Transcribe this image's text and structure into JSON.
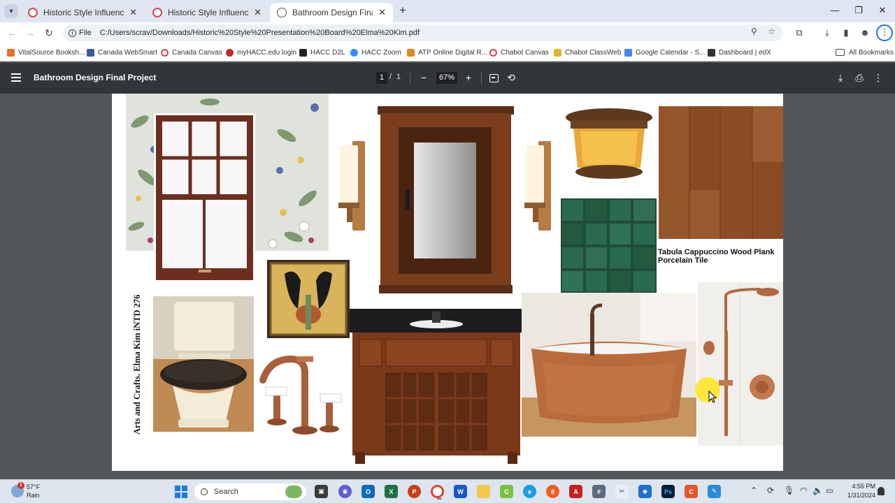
{
  "browser": {
    "tabs": [
      {
        "label": "Historic Style Influence Project",
        "favicon": "canvas-icon",
        "active": false
      },
      {
        "label": "Historic Style Influence Project",
        "favicon": "canvas-icon",
        "active": false
      },
      {
        "label": "Bathroom Design Final Project",
        "favicon": "globe-icon",
        "active": true
      }
    ],
    "new_tab": "+",
    "window_controls": {
      "minimize": "—",
      "restore": "❐",
      "close": "✕"
    },
    "address": {
      "scheme_label": "File",
      "url": "C:/Users/scrav/Downloads/Historic%20Style%20Presentation%20Board%20Elma%20Kim.pdf"
    },
    "bookmarks": [
      {
        "label": "VitalSource Booksh...",
        "color": "#e2722b"
      },
      {
        "label": "Canada WebSmart",
        "color": "#3b5998"
      },
      {
        "label": "Canada Canvas",
        "color": "#d64545"
      },
      {
        "label": "myHACC.edu login",
        "color": "#c62828"
      },
      {
        "label": "HACC D2L",
        "color": "#222222"
      },
      {
        "label": "HACC Zoom",
        "color": "#2d8cff"
      },
      {
        "label": "ATP Online Digital R...",
        "color": "#e08a1e"
      },
      {
        "label": "Chabot Canvas",
        "color": "#d64545"
      },
      {
        "label": "Chabot ClassWeb",
        "color": "#e4b42a"
      },
      {
        "label": "Google Calendar - S...",
        "color": "#4285f4"
      },
      {
        "label": "Dashboard | edX",
        "color": "#333333"
      }
    ],
    "all_bookmarks": "All Bookmarks"
  },
  "pdf": {
    "title": "Bathroom Design Final Project",
    "page_current": "1",
    "page_separator": "/",
    "page_total": "1",
    "zoom": "67%",
    "board": {
      "vertical_text": "Arts and Crafts. Elma Kim iNTD 276",
      "tile_caption": "Tabula Cappuccino Wood Plank Porcelain Tile"
    }
  },
  "taskbar": {
    "weather_temp": "57°F",
    "weather_desc": "Rain",
    "weather_badge": "1",
    "search_label": "Search",
    "time": "4:55 PM",
    "date": "1/31/2024"
  }
}
